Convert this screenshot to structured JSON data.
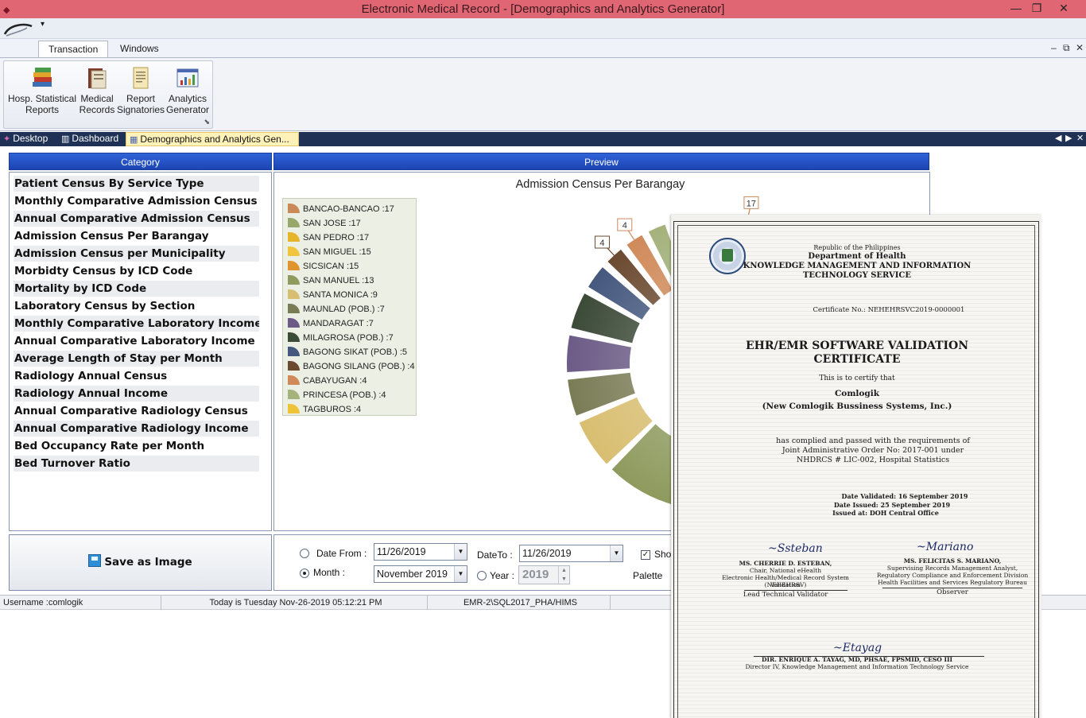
{
  "window": {
    "title": "Electronic Medical Record - [Demographics and Analytics Generator]",
    "minimize": "—",
    "restore": "❐",
    "close": "✕"
  },
  "qat": {
    "dropdown": "▾"
  },
  "ribbon": {
    "tabs": [
      {
        "label": "Transaction"
      },
      {
        "label": "Windows"
      }
    ],
    "mdi": {
      "minimize": "–",
      "restore": "⧉",
      "close": "✕"
    },
    "buttons": [
      {
        "line1": "Hosp. Statistical",
        "line2": "Reports",
        "icon": "books-icon"
      },
      {
        "line1": "Medical",
        "line2": "Records",
        "icon": "folder-records-icon"
      },
      {
        "line1": "Report",
        "line2": "Signatories",
        "icon": "document-icon"
      },
      {
        "line1": "Analytics",
        "line2": "Generator",
        "icon": "analytics-chart-icon"
      }
    ],
    "dialog_launcher": "⬊"
  },
  "doctabs": [
    {
      "label": "Desktop",
      "icon": "desktop-icon"
    },
    {
      "label": "Dashboard",
      "icon": "dashboard-icon"
    },
    {
      "label": "Demographics and Analytics Gen...",
      "icon": "chart-icon"
    }
  ],
  "strip_buttons": {
    "left": "◀",
    "right": "▶",
    "close": "✕"
  },
  "category": {
    "header": "Category",
    "items": [
      "Patient Census By Service Type",
      "Monthly Comparative Admission Census",
      "Annual Comparative Admission Census",
      "Admission Census Per Barangay",
      "Admission Census per Municipality",
      "Morbidty Census by ICD Code",
      "Mortality by ICD Code",
      "Laboratory Census by Section",
      "Monthly Comparative Laboratory Income",
      "Annual Comparative Laboratory Income",
      "Average Length of Stay per Month",
      "Radiology Annual Census",
      "Radiology Annual Income",
      "Annual Comparative Radiology Census",
      "Annual Comparative Radiology Income",
      "Bed Occupancy Rate  per Month",
      "Bed Turnover Ratio"
    ]
  },
  "preview": {
    "header": "Preview"
  },
  "chart_data": {
    "type": "pie",
    "title": "Admission Census Per Barangay",
    "legend_position": "top-left",
    "categories": [
      "BANCAO-BANCAO",
      "SAN JOSE",
      "SAN PEDRO",
      "SAN MIGUEL",
      "SICSICAN",
      "SAN MANUEL",
      "SANTA MONICA",
      "MAUNLAD (POB.)",
      "MANDARAGAT",
      "MILAGROSA (POB.)",
      "BAGONG SIKAT (POB.)",
      "BAGONG SILANG (POB.)",
      "CABAYUGAN",
      "PRINCESA (POB.)",
      "TAGBUROS"
    ],
    "values": [
      17,
      17,
      17,
      15,
      15,
      13,
      9,
      7,
      7,
      7,
      5,
      4,
      4,
      4,
      4
    ],
    "legend_labels": [
      "BANCAO-BANCAO :17",
      "SAN JOSE :17",
      "SAN PEDRO :17",
      "SAN MIGUEL :15",
      "SICSICAN :15",
      "SAN MANUEL :13",
      "SANTA MONICA :9",
      "MAUNLAD (POB.) :7",
      "MANDARAGAT :7",
      "MILAGROSA (POB.) :7",
      "BAGONG SIKAT (POB.) :5",
      "BAGONG SILANG (POB.) :4",
      "CABAYUGAN :4",
      "PRINCESA (POB.) :4",
      "TAGBUROS :4"
    ],
    "colors": [
      "#c98a58",
      "#96a86a",
      "#e6b52a",
      "#f0c43e",
      "#e0942e",
      "#8f9a5e",
      "#d8be70",
      "#7a7c56",
      "#6c5b86",
      "#3c4a38",
      "#45587e",
      "#6b4a30",
      "#d08a5a",
      "#a5b27c",
      "#edc437"
    ],
    "visible_data_labels": [
      "17",
      "17",
      "17",
      "15",
      "4",
      "4"
    ]
  },
  "save": {
    "label": "Save as Image",
    "icon": "save-image-icon"
  },
  "filter": {
    "date_from_label": "Date From :",
    "date_from_value": "11/26/2019",
    "date_to_label": "DateTo :",
    "date_to_value": "11/26/2019",
    "month_label": "Month :",
    "month_value": "November 2019",
    "year_label": "Year :",
    "year_value": "2019",
    "show_label": "Sho",
    "palette_label": "Palette",
    "mode": "month"
  },
  "status": {
    "username": "Username :comlogik",
    "today": "Today is Tuesday Nov-26-2019 05:12:21 PM",
    "server": "EMR-2\\SQL2017_PHA/HIMS"
  },
  "certificate": {
    "republic": "Republic of the Philippines",
    "dept": "Department of Health",
    "office1": "KNOWLEDGE MANAGEMENT AND INFORMATION",
    "office2": "TECHNOLOGY SERVICE",
    "cert_no": "Certificate No.: NEHEHRSVC2019-0000001",
    "title1": "EHR/EMR SOFTWARE VALIDATION",
    "title2": "CERTIFICATE",
    "certify": "This is to certify that",
    "company1": "Comlogik",
    "company2": "(New Comlogik Bussiness Systems, Inc.)",
    "complied1": "has complied and passed with the requirements of",
    "complied2": "Joint Administrative Order No: 2017-001 under",
    "complied3": "NHDRCS # LIC-002, Hospital Statistics",
    "validated": "Date Validated: 16 September 2019",
    "issued": "Date Issued:  25 September 2019",
    "issued_at": "Issued at: DOH Central Office",
    "sig1_name": "MS. CHERRIE D. ESTEBAN,",
    "sig1_t1": "Chair, National eHealth",
    "sig1_t2": "Electronic Health/Medical Record System Validation",
    "sig1_t3": "(NEHEHRSV)",
    "sig1_role": "Lead Technical Validator",
    "sig2_name": "MS. FELICITAS S. MARIANO,",
    "sig2_t1": "Supervising Records Management Analyst,",
    "sig2_t2": "Regulatory Compliance and Enforcement Division",
    "sig2_t3": "Health Facilities and Services Regulatory Bureau",
    "sig2_role": "Observer",
    "sig3_name": "DIR. ENRIQUE A. TAYAG, MD, PHSAE, FPSMID, CESO III",
    "sig3_t1": "Director IV, Knowledge Management and Information Technology Service"
  }
}
